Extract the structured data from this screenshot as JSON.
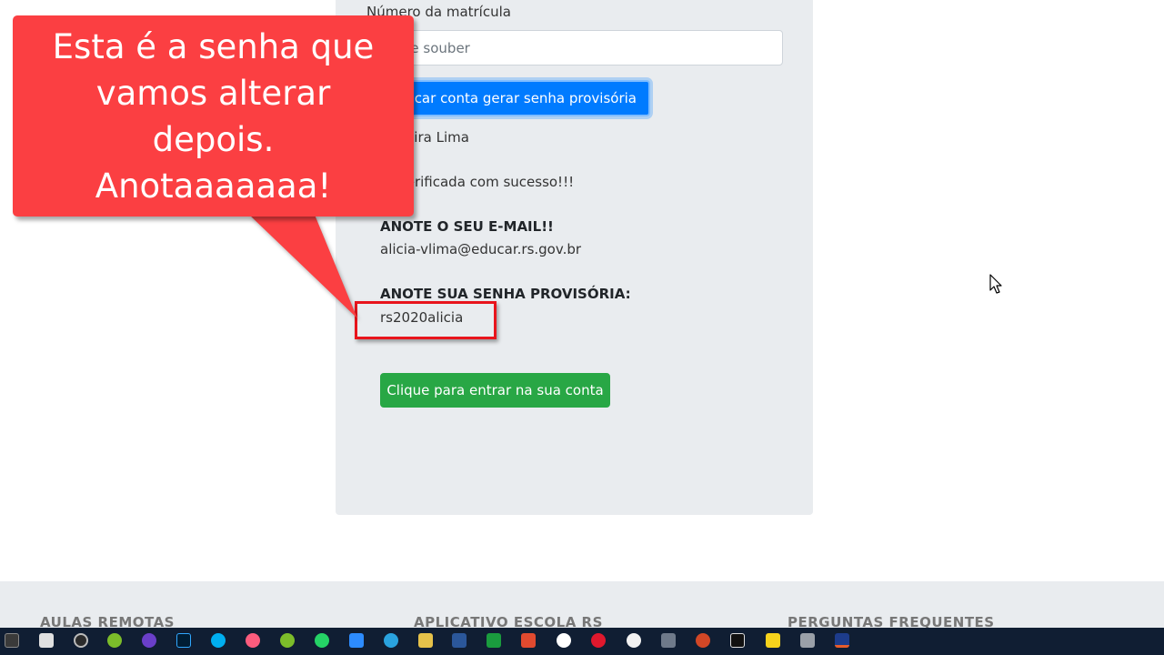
{
  "form": {
    "matricula_label": "Número da matrícula",
    "matricula_placeholder": "me se souber",
    "verify_button": "rificar conta gerar senha provisória",
    "student_name": "a Vieira Lima",
    "verified_message": "ta verificada com sucesso!!!",
    "email_title": "ANOTE O SEU E-MAIL!!",
    "email_value": "alicia-vlima@educar.rs.gov.br",
    "password_title": "ANOTE SUA SENHA PROVISÓRIA:",
    "password_value": "rs2020alicia",
    "enter_button": "Clique para entrar na sua conta"
  },
  "callout": {
    "line1": "Esta é a senha que",
    "line2": "vamos alterar",
    "line3": "depois.",
    "line4": "Anotaaaaaaa!"
  },
  "footer": {
    "col1": "AULAS REMOTAS",
    "col2": "APLICATIVO ESCOLA RS",
    "col3": "PERGUNTAS FREQUENTES"
  },
  "colors": {
    "primary": "#007bff",
    "success": "#28a745",
    "callout": "#fb3f42",
    "highlight": "#e8141c",
    "taskbar": "#101e33"
  },
  "taskbar_icons": [
    "app-icon",
    "calculator-icon",
    "obs-icon",
    "android-icon",
    "circle-app-icon",
    "photoshop-icon",
    "skype-icon",
    "itunes-icon",
    "android-studio-icon",
    "whatsapp-icon",
    "zoom-icon",
    "telegram-icon",
    "paint-icon",
    "word-icon",
    "camtasia-icon",
    "recorder-icon",
    "chrome-icon",
    "opera-icon",
    "fingerprint-icon",
    "folder-icon",
    "powerpoint-icon",
    "camera-icon",
    "notes-icon",
    "volume-icon",
    "screen-app-icon"
  ]
}
